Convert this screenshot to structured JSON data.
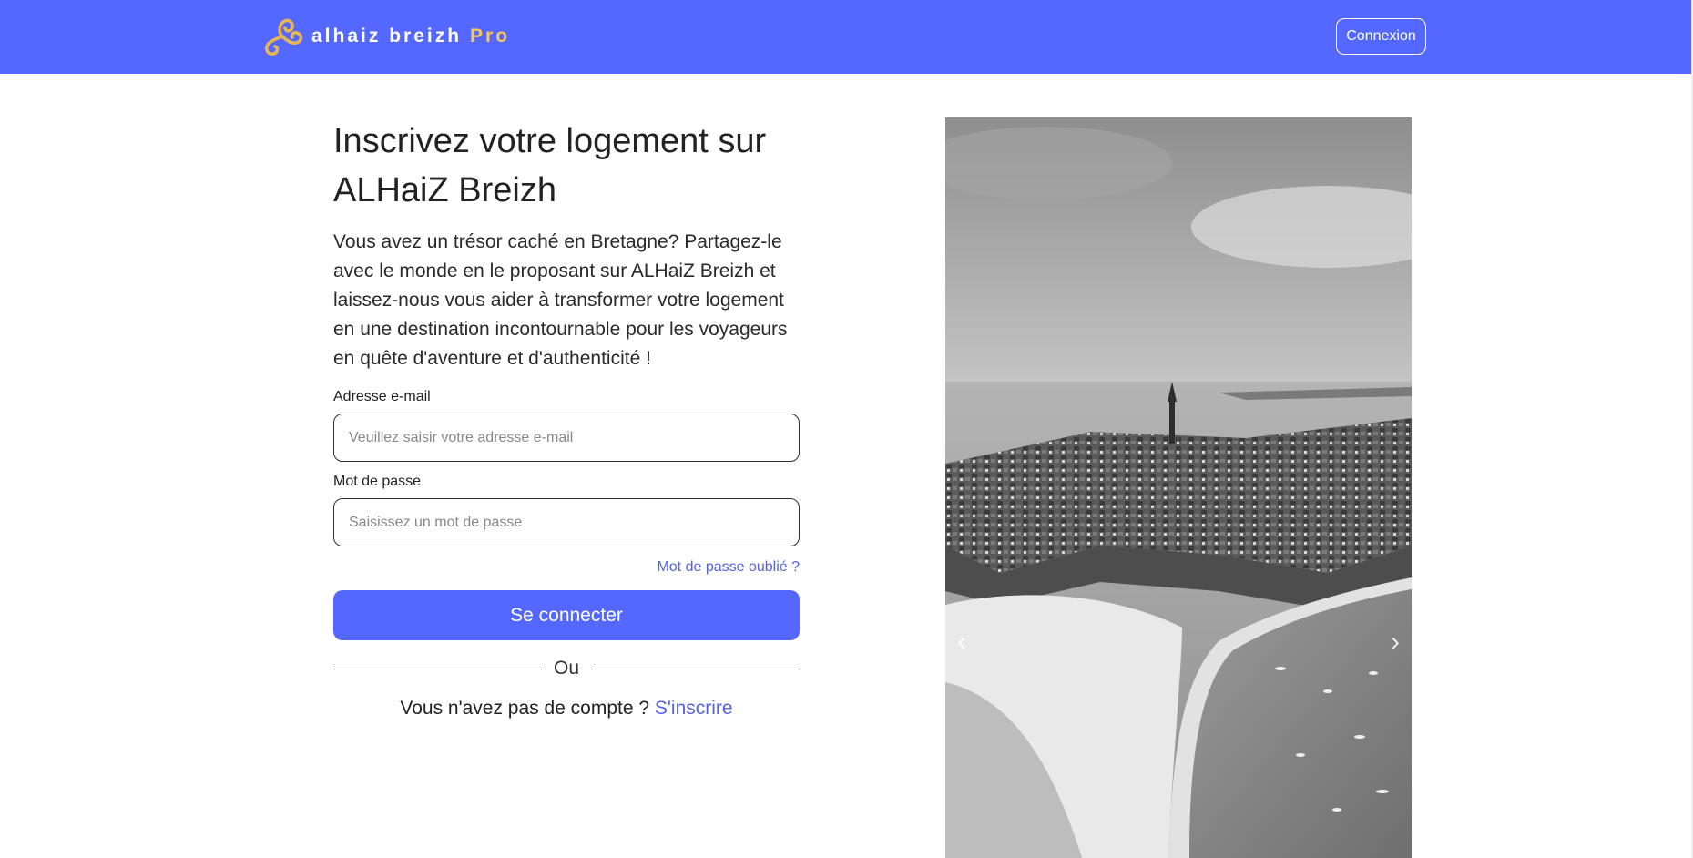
{
  "header": {
    "brand_name": "alhaiz breizh",
    "brand_suffix": "Pro",
    "logo_icon": "triskele-icon",
    "login_label": "Connexion"
  },
  "form": {
    "title": "Inscrivez votre logement sur ALHaiZ Breizh",
    "intro": "Vous avez un trésor caché en Bretagne? Partagez-le avec le monde en le proposant sur ALHaiZ Breizh et laissez-nous vous aider à transformer votre logement en une destination incontournable pour les voyageurs en quête d'aventure et d'authenticité !",
    "email_label": "Adresse e-mail",
    "email_placeholder": "Veuillez saisir votre adresse e-mail",
    "password_label": "Mot de passe",
    "password_placeholder": "Saisissez un mot de passe",
    "forgot_password": "Mot de passe oublié ?",
    "submit_label": "Se connecter",
    "divider_text": "Ou",
    "no_account_text": "Vous n'avez pas de compte ?",
    "signup_label": "S'inscrire"
  },
  "carousel": {
    "prev_icon": "chevron-left-icon",
    "next_icon": "chevron-right-icon",
    "prev_glyph": "‹",
    "next_glyph": "›"
  },
  "colors": {
    "primary": "#5468ff",
    "brand_accent": "#f7c75a",
    "link": "#5563e0"
  }
}
